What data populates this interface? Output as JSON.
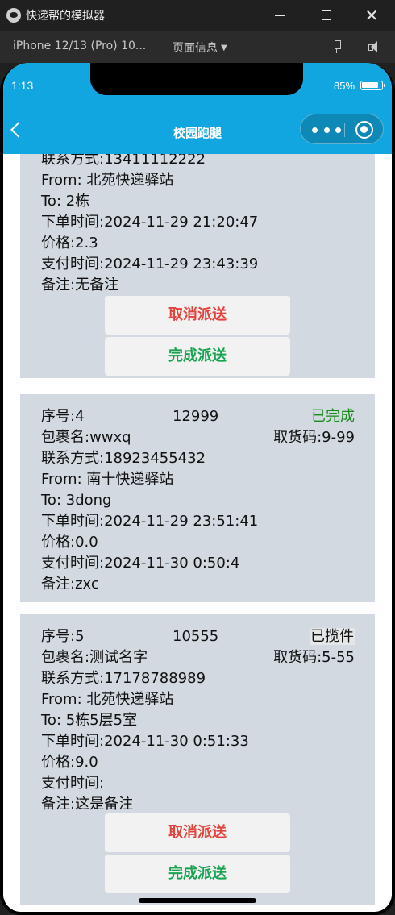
{
  "window": {
    "title": "快递帮的模拟器"
  },
  "toolbar": {
    "device": "iPhone 12/13 (Pro) 10...",
    "page_info": "页面信息"
  },
  "statusbar": {
    "time": "1:13",
    "battery": "85%",
    "battery_level": 0.85
  },
  "nav": {
    "title": "校园跑腿"
  },
  "cards": [
    {
      "contact": "联系方式:13411112222",
      "from": "From: 北苑快递驿站",
      "to": "To: 2栋",
      "order_time": "下单时间:2024-11-29 21:20:47",
      "price": "价格:2.3",
      "pay_time": "支付时间:2024-11-29 23:43:39",
      "note": "备注:无备注",
      "cancel_label": "取消派送",
      "complete_label": "完成派送"
    },
    {
      "seq": "序号:4",
      "code": "12999",
      "status": "已完成",
      "package": "包裹名:wwxq",
      "pickup": "取货码:9-99",
      "contact": "联系方式:18923455432",
      "from": "From: 南十快递驿站",
      "to": "To: 3dong",
      "order_time": "下单时间:2024-11-29 23:51:41",
      "price": "价格:0.0",
      "pay_time": "支付时间:2024-11-30 0:50:4",
      "note": "备注:zxc"
    },
    {
      "seq": "序号:5",
      "code": "10555",
      "status": "已揽件",
      "package": "包裹名:测试名字",
      "pickup": "取货码:5-55",
      "contact": "联系方式:17178788989",
      "from": "From: 北苑快递驿站",
      "to": "To: 5栋5层5室",
      "order_time": "下单时间:2024-11-30 0:51:33",
      "price": "价格:9.0",
      "pay_time": "支付时间:",
      "note": "备注:这是备注",
      "cancel_label": "取消派送",
      "complete_label": "完成派送"
    }
  ],
  "colors": {
    "header": "#11a6e0",
    "card": "#d2d9e0",
    "cancel": "#e2443d",
    "complete": "#19a350",
    "status_done": "#1a8a1a"
  }
}
